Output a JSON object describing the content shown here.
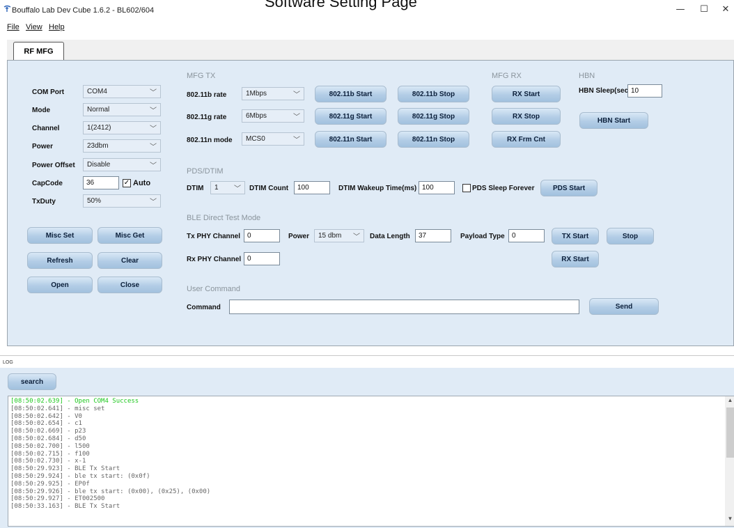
{
  "window": {
    "app_icon": "bouffalo-logo-icon",
    "title": "Bouffalo Lab Dev Cube 1.6.2 - BL602/604",
    "ghost_title": "Software Setting Page",
    "controls": {
      "minimize": "—",
      "maximize": "☐",
      "close": "✕"
    }
  },
  "menu": {
    "file": "File",
    "view": "View",
    "help": "Help"
  },
  "tab": {
    "label": "RF MFG"
  },
  "left": {
    "com_port": {
      "label": "COM Port",
      "value": "COM4"
    },
    "mode": {
      "label": "Mode",
      "value": "Normal"
    },
    "channel": {
      "label": "Channel",
      "value": "1(2412)"
    },
    "power": {
      "label": "Power",
      "value": "23dbm"
    },
    "power_offset": {
      "label": "Power Offset",
      "value": "Disable"
    },
    "capcode": {
      "label": "CapCode",
      "value": "36",
      "auto_label": "Auto",
      "auto_checked": true
    },
    "txduty": {
      "label": "TxDuty",
      "value": "50%"
    },
    "buttons": {
      "misc_set": "Misc Set",
      "misc_get": "Misc Get",
      "refresh": "Refresh",
      "clear": "Clear",
      "open": "Open",
      "close": "Close"
    }
  },
  "mfg_tx": {
    "title": "MFG TX",
    "b_rate": {
      "label": "802.11b rate",
      "value": "1Mbps",
      "start": "802.11b Start",
      "stop": "802.11b Stop"
    },
    "g_rate": {
      "label": "802.11g rate",
      "value": "6Mbps",
      "start": "802.11g Start",
      "stop": "802.11g Stop"
    },
    "n_mode": {
      "label": "802.11n mode",
      "value": "MCS0",
      "start": "802.11n Start",
      "stop": "802.11n Stop"
    }
  },
  "mfg_rx": {
    "title": "MFG RX",
    "rx_start": "RX Start",
    "rx_stop": "RX Stop",
    "rx_frm_cnt": "RX Frm Cnt"
  },
  "hbn": {
    "title": "HBN",
    "sleep_label": "HBN Sleep(sec)",
    "sleep_value": "10",
    "start": "HBN Start"
  },
  "pds": {
    "title": "PDS/DTIM",
    "dtim_label": "DTIM",
    "dtim_value": "1",
    "dtim_count_label": "DTIM Count",
    "dtim_count_value": "100",
    "wakeup_label": "DTIM Wakeup Time(ms)",
    "wakeup_value": "100",
    "sleep_forever_label": "PDS Sleep Forever",
    "sleep_forever_checked": false,
    "start": "PDS Start"
  },
  "ble": {
    "title": "BLE Direct Test Mode",
    "tx_channel_label": "Tx PHY Channel",
    "tx_channel_value": "0",
    "power_label": "Power",
    "power_value": "15 dbm",
    "data_length_label": "Data Length",
    "data_length_value": "37",
    "payload_label": "Payload Type",
    "payload_value": "0",
    "tx_start": "TX Start",
    "stop": "Stop",
    "rx_channel_label": "Rx PHY Channel",
    "rx_channel_value": "0",
    "rx_start": "RX Start"
  },
  "user_cmd": {
    "title": "User Command",
    "label": "Command",
    "value": "",
    "send": "Send"
  },
  "log": {
    "header": "LOG",
    "search": "search",
    "lines": [
      {
        "text": "[08:50:02.639] - Open COM4 Success",
        "ok": true
      },
      {
        "text": "[08:50:02.641] - misc set"
      },
      {
        "text": "[08:50:02.642] - V0"
      },
      {
        "text": "[08:50:02.654] - c1"
      },
      {
        "text": "[08:50:02.669] - p23"
      },
      {
        "text": "[08:50:02.684] - d50"
      },
      {
        "text": "[08:50:02.700] - l500"
      },
      {
        "text": "[08:50:02.715] - f100"
      },
      {
        "text": "[08:50:02.730] - x-1"
      },
      {
        "text": "[08:50:29.923] - BLE Tx Start"
      },
      {
        "text": "[08:50:29.924] - ble tx start: (0x0f)"
      },
      {
        "text": "[08:50:29.925] - EP0f"
      },
      {
        "text": "[08:50:29.926] - ble tx start: (0x00), (0x25), (0x00)"
      },
      {
        "text": "[08:50:29.927] - ET002500"
      },
      {
        "text": "[08:50:33.163] - BLE Tx Start"
      }
    ]
  },
  "colors": {
    "panel_bg": "#e0ebf6",
    "button_top": "#d9e8f6",
    "button_bottom": "#a2c1de",
    "log_ok": "#1ec81e",
    "section_title": "#8a949c"
  }
}
